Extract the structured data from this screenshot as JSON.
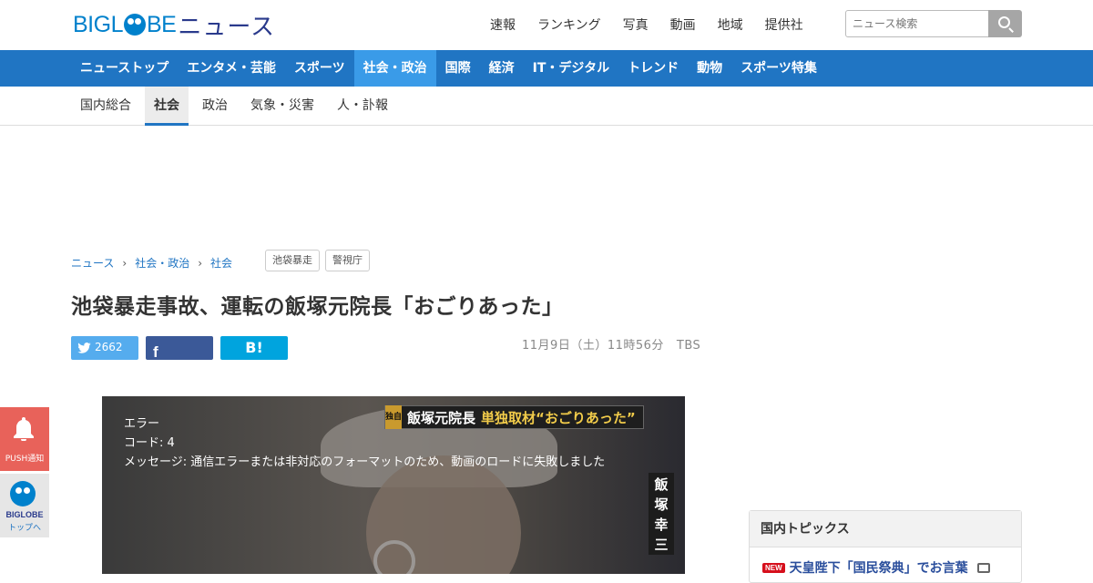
{
  "header": {
    "logo_brand": "BIGL",
    "logo_brand_tail": "BE",
    "logo_news": "ニュース",
    "top_nav": [
      "速報",
      "ランキング",
      "写真",
      "動画",
      "地域",
      "提供社"
    ],
    "search_placeholder": "ニュース検索"
  },
  "category_nav": {
    "items": [
      "ニューストップ",
      "エンタメ・芸能",
      "スポーツ",
      "社会・政治",
      "国際",
      "経済",
      "IT・デジタル",
      "トレンド",
      "動物",
      "スポーツ特集"
    ],
    "active_index": 3
  },
  "sub_nav": {
    "items": [
      "国内総合",
      "社会",
      "政治",
      "気象・災害",
      "人・訃報"
    ],
    "active_index": 1
  },
  "breadcrumb": [
    "ニュース",
    "社会・政治",
    "社会"
  ],
  "tags": [
    "池袋暴走",
    "警視庁"
  ],
  "article": {
    "title": "池袋暴走事故、運転の飯塚元院長「おごりあった」",
    "twitter_count": "2662",
    "hatena_label": "B!",
    "date": "11月9日（土）11時56分",
    "source": "TBS"
  },
  "video": {
    "banner_tag": "独自",
    "banner_name": "飯塚元院長",
    "banner_quote": "単独取材“おごりあった”",
    "side_caption": "飯塚幸三",
    "error_lines": [
      "エラー",
      "コード: 4",
      "メッセージ: 通信エラーまたは非対応のフォーマットのため、動画のロードに失敗しました"
    ]
  },
  "sidebar": {
    "heading": "国内トピックス",
    "items": [
      {
        "badge": "NEW",
        "text": "天皇陛下「国民祭典」でお言葉"
      }
    ]
  },
  "floating": {
    "push_label": "PUSH通知",
    "biglobe_label": "BIGLOBE",
    "biglobe_sub": "トップへ"
  },
  "colors": {
    "brand_blue": "#0081cc",
    "nav_blue": "#2075c3",
    "nav_active": "#3a9be8",
    "push_red": "#e8625a"
  }
}
